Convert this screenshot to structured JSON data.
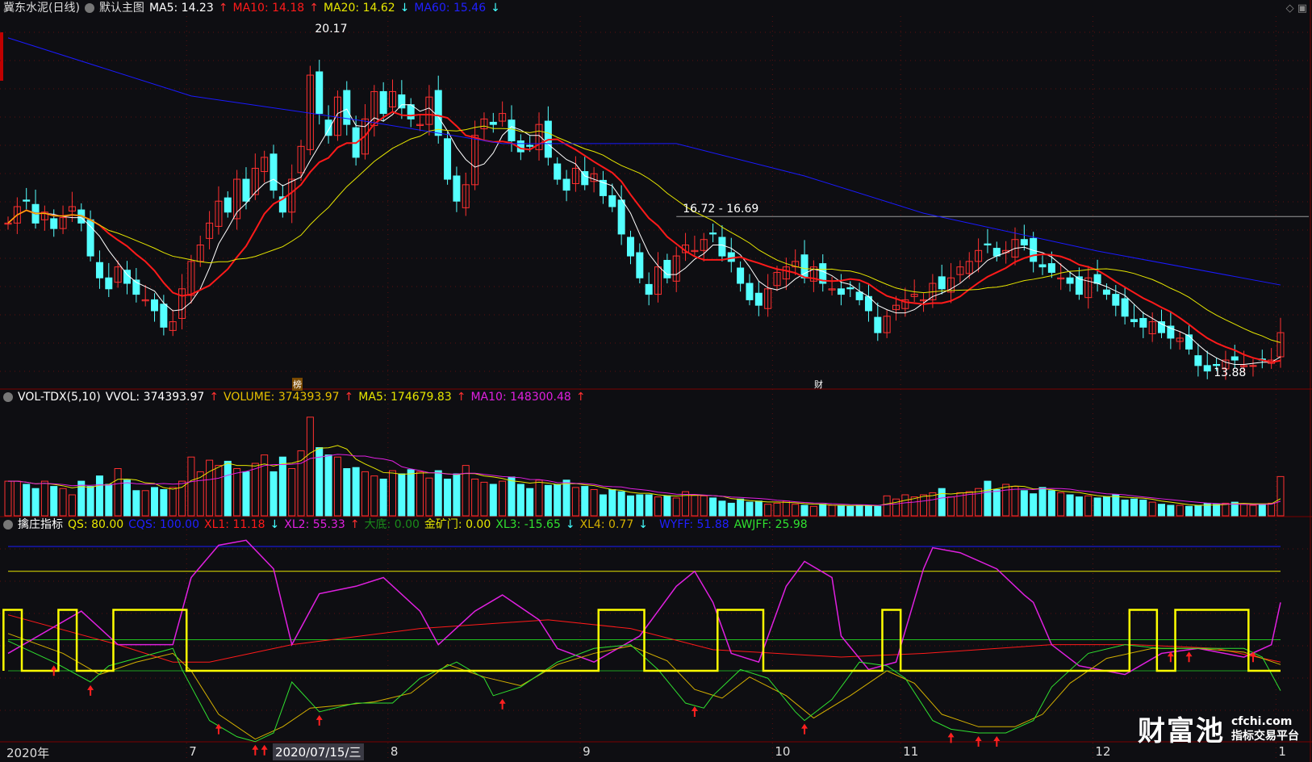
{
  "header": {
    "stock_name": "冀东水泥(日线)",
    "template": "默认主图",
    "ma5": "MA5: 14.23",
    "ma10": "MA10: 14.18",
    "ma20": "MA20: 14.62",
    "ma60": "MA60: 15.46",
    "ma5_dir": "↑",
    "ma10_dir": "↑",
    "ma20_dir": "↓",
    "ma60_dir": "↓"
  },
  "volume_header": {
    "name": "VOL-TDX(5,10)",
    "vvol": "VVOL: 374393.97",
    "volume": "VOLUME: 374393.97",
    "ma5": "MA5: 174679.83",
    "ma10": "MA10: 148300.48",
    "arrow": "↑"
  },
  "indicator_header": {
    "name": "擒庄指标",
    "qs": "QS: 80.00",
    "cqs": "CQS: 100.00",
    "xl1": "XL1: 11.18",
    "xl1_dir": "↓",
    "xl2": "XL2: 55.33",
    "xl2_dir": "↑",
    "dadi": "大底: 0.00",
    "jinkuangmen": "金矿门: 0.00",
    "xl3": "XL3: -15.65",
    "xl3_dir": "↓",
    "xl4": "XL4: 0.77",
    "xl4_dir": "↓",
    "wyff": "WYFF: 51.88",
    "awjff": "AWJFF: 25.98"
  },
  "annotations": {
    "high": "20.17",
    "low": "13.88",
    "range": "16.72 - 16.69",
    "mark1": "榜",
    "mark2": "财"
  },
  "axis": {
    "year": "2020年",
    "months": [
      "7",
      "8",
      "9",
      "10",
      "11",
      "12",
      "1"
    ],
    "cursor_date": "2020/07/15/三"
  },
  "logo": {
    "name": "财富池",
    "domain": "cfchi.com",
    "slogan": "指标交易平台"
  },
  "colors": {
    "up": "#ff3030",
    "down": "#54ffff",
    "ma5": "#ffffff",
    "ma10": "#ff1a1a",
    "ma20": "#e6e600",
    "ma60": "#1a1aff"
  },
  "chart_data": {
    "type": "candlestick",
    "price_range": [
      13.88,
      20.17
    ],
    "closes": [
      16.6,
      16.9,
      17.0,
      16.6,
      16.8,
      16.5,
      16.7,
      16.9,
      16.6,
      16.0,
      15.6,
      15.4,
      15.8,
      15.5,
      15.3,
      15.2,
      15.0,
      14.7,
      14.8,
      15.4,
      15.9,
      16.2,
      16.6,
      17.0,
      16.8,
      17.4,
      17.0,
      17.6,
      17.8,
      17.2,
      16.8,
      17.4,
      18.0,
      19.3,
      18.6,
      18.2,
      18.9,
      18.4,
      17.8,
      18.5,
      19.0,
      18.6,
      19.0,
      18.7,
      18.5,
      18.4,
      18.9,
      18.2,
      17.4,
      17.0,
      17.3,
      18.2,
      18.5,
      18.4,
      18.6,
      18.1,
      17.9,
      18.0,
      18.4,
      17.8,
      17.4,
      17.2,
      17.6,
      17.3,
      17.5,
      17.1,
      16.9,
      16.4,
      16.0,
      15.6,
      15.3,
      15.8,
      15.6,
      16.0,
      16.2,
      16.1,
      16.3,
      16.4,
      16.0,
      15.9,
      15.5,
      15.2,
      15.1,
      15.4,
      15.7,
      15.8,
      15.9,
      15.6,
      15.8,
      15.5,
      15.4,
      15.3,
      15.4,
      15.2,
      15.0,
      14.6,
      14.9,
      15.1,
      15.2,
      15.3,
      15.2,
      15.5,
      15.4,
      15.6,
      15.8,
      15.9,
      16.1,
      16.2,
      16.0,
      16.1,
      16.3,
      16.2,
      15.9,
      15.8,
      15.7,
      15.6,
      15.5,
      15.3,
      15.6,
      15.5,
      15.3,
      15.1,
      14.9,
      14.8,
      14.7,
      14.8,
      14.6,
      14.5,
      14.5,
      14.3,
      14.0,
      13.9,
      14.0,
      14.1,
      14.1,
      14.0,
      14.0,
      14.1,
      14.1,
      14.6
    ],
    "volumes_thousand": [
      330,
      330,
      300,
      260,
      330,
      280,
      260,
      200,
      330,
      280,
      380,
      300,
      450,
      340,
      240,
      240,
      270,
      250,
      270,
      330,
      560,
      420,
      530,
      480,
      520,
      450,
      420,
      500,
      580,
      420,
      560,
      450,
      620,
      940,
      650,
      580,
      560,
      450,
      460,
      420,
      380,
      350,
      430,
      400,
      440,
      420,
      360,
      430,
      350,
      400,
      480,
      350,
      320,
      300,
      330,
      370,
      300,
      260,
      340,
      290,
      300,
      340,
      270,
      280,
      250,
      200,
      250,
      230,
      190,
      200,
      200,
      180,
      190,
      170,
      230,
      200,
      190,
      170,
      140,
      120,
      160,
      130,
      140,
      110,
      120,
      140,
      110,
      100,
      90,
      110,
      100,
      100,
      90,
      100,
      100,
      90,
      190,
      160,
      200,
      180,
      200,
      220,
      260,
      180,
      220,
      230,
      260,
      330,
      250,
      300,
      280,
      240,
      210,
      270,
      240,
      220,
      200,
      180,
      190,
      170,
      180,
      200,
      150,
      160,
      150,
      130,
      110,
      100,
      100,
      90,
      100,
      120,
      110,
      120,
      130,
      110,
      100,
      110,
      120,
      374
    ],
    "ma60_points": [
      [
        0,
        19.98
      ],
      [
        20,
        18.92
      ],
      [
        39,
        18.46
      ],
      [
        54,
        18.05
      ],
      [
        73,
        18.05
      ],
      [
        87,
        17.46
      ],
      [
        100,
        16.78
      ],
      [
        119,
        16.09
      ],
      [
        139,
        15.47
      ]
    ],
    "month_start_index": [
      20,
      42,
      63,
      84,
      98,
      119,
      139
    ],
    "indicator": {
      "levels": [
        100,
        80,
        25,
        0
      ],
      "xl1": [
        [
          0,
          45
        ],
        [
          12,
          21
        ],
        [
          18,
          7
        ],
        [
          22,
          7
        ],
        [
          31,
          21
        ],
        [
          45,
          34
        ],
        [
          59,
          41
        ],
        [
          68,
          34
        ],
        [
          77,
          17
        ],
        [
          91,
          11
        ],
        [
          100,
          14
        ],
        [
          114,
          21
        ],
        [
          123,
          21
        ],
        [
          132,
          18
        ],
        [
          139,
          7
        ]
      ],
      "xl2": [
        [
          0,
          14
        ],
        [
          8,
          48
        ],
        [
          12,
          21
        ],
        [
          18,
          21
        ],
        [
          20,
          75
        ],
        [
          23,
          101
        ],
        [
          26,
          105
        ],
        [
          29,
          82
        ],
        [
          31,
          21
        ],
        [
          34,
          62
        ],
        [
          38,
          68
        ],
        [
          41,
          75
        ],
        [
          45,
          48
        ],
        [
          47,
          21
        ],
        [
          51,
          48
        ],
        [
          54,
          61
        ],
        [
          58,
          41
        ],
        [
          60,
          18
        ],
        [
          64,
          7
        ],
        [
          69,
          28
        ],
        [
          73,
          68
        ],
        [
          75,
          80
        ],
        [
          77,
          55
        ],
        [
          79,
          14
        ],
        [
          82,
          7
        ],
        [
          85,
          68
        ],
        [
          87,
          88
        ],
        [
          90,
          75
        ],
        [
          91,
          28
        ],
        [
          94,
          1
        ],
        [
          97,
          7
        ],
        [
          100,
          82
        ],
        [
          101,
          99
        ],
        [
          104,
          95
        ],
        [
          108,
          82
        ],
        [
          111,
          61
        ],
        [
          112,
          55
        ],
        [
          114,
          21
        ],
        [
          117,
          4
        ],
        [
          122,
          -3
        ],
        [
          126,
          14
        ],
        [
          130,
          18
        ],
        [
          135,
          11
        ],
        [
          138,
          21
        ],
        [
          139,
          55
        ]
      ],
      "xl3": [
        [
          0,
          24
        ],
        [
          5,
          7
        ],
        [
          9,
          -9
        ],
        [
          11,
          4
        ],
        [
          18,
          18
        ],
        [
          19,
          1
        ],
        [
          22,
          -40
        ],
        [
          25,
          -53
        ],
        [
          27,
          -57
        ],
        [
          29,
          -50
        ],
        [
          31,
          -9
        ],
        [
          34,
          -33
        ],
        [
          38,
          -26
        ],
        [
          42,
          -26
        ],
        [
          45,
          -6
        ],
        [
          49,
          7
        ],
        [
          52,
          -6
        ],
        [
          53,
          -20
        ],
        [
          56,
          -13
        ],
        [
          60,
          7
        ],
        [
          64,
          18
        ],
        [
          68,
          21
        ],
        [
          71,
          1
        ],
        [
          74,
          -26
        ],
        [
          76,
          -30
        ],
        [
          77,
          -20
        ],
        [
          80,
          1
        ],
        [
          83,
          -6
        ],
        [
          86,
          -33
        ],
        [
          87,
          -40
        ],
        [
          90,
          -23
        ],
        [
          93,
          7
        ],
        [
          96,
          4
        ],
        [
          98,
          -6
        ],
        [
          101,
          -40
        ],
        [
          103,
          -47
        ],
        [
          106,
          -50
        ],
        [
          109,
          -50
        ],
        [
          112,
          -40
        ],
        [
          114,
          -13
        ],
        [
          118,
          14
        ],
        [
          122,
          21
        ],
        [
          126,
          18
        ],
        [
          130,
          18
        ],
        [
          135,
          18
        ],
        [
          137,
          11
        ],
        [
          139,
          -16
        ]
      ],
      "xl4": [
        [
          0,
          30
        ],
        [
          6,
          14
        ],
        [
          10,
          -3
        ],
        [
          14,
          7
        ],
        [
          18,
          14
        ],
        [
          20,
          0
        ],
        [
          23,
          -35
        ],
        [
          27,
          -55
        ],
        [
          30,
          -45
        ],
        [
          33,
          -30
        ],
        [
          36,
          -28
        ],
        [
          40,
          -25
        ],
        [
          44,
          -18
        ],
        [
          48,
          5
        ],
        [
          52,
          -5
        ],
        [
          56,
          -12
        ],
        [
          60,
          5
        ],
        [
          64,
          14
        ],
        [
          68,
          20
        ],
        [
          72,
          8
        ],
        [
          75,
          -15
        ],
        [
          78,
          -22
        ],
        [
          81,
          -5
        ],
        [
          85,
          -20
        ],
        [
          88,
          -38
        ],
        [
          92,
          -20
        ],
        [
          96,
          0
        ],
        [
          99,
          -10
        ],
        [
          102,
          -35
        ],
        [
          106,
          -45
        ],
        [
          110,
          -45
        ],
        [
          113,
          -35
        ],
        [
          116,
          -10
        ],
        [
          120,
          10
        ],
        [
          125,
          18
        ],
        [
          130,
          18
        ],
        [
          135,
          15
        ],
        [
          139,
          5
        ]
      ],
      "qs_high_ranges": [
        [
          0,
          1
        ],
        [
          6,
          7
        ],
        [
          12,
          19
        ],
        [
          65,
          69
        ],
        [
          78,
          82
        ],
        [
          96,
          97
        ],
        [
          123,
          125
        ],
        [
          128,
          135
        ]
      ],
      "qs_high": 49,
      "arrows": [
        5,
        9,
        23,
        27,
        28,
        34,
        54,
        75,
        87,
        103,
        106,
        108,
        127,
        129,
        136
      ]
    }
  }
}
